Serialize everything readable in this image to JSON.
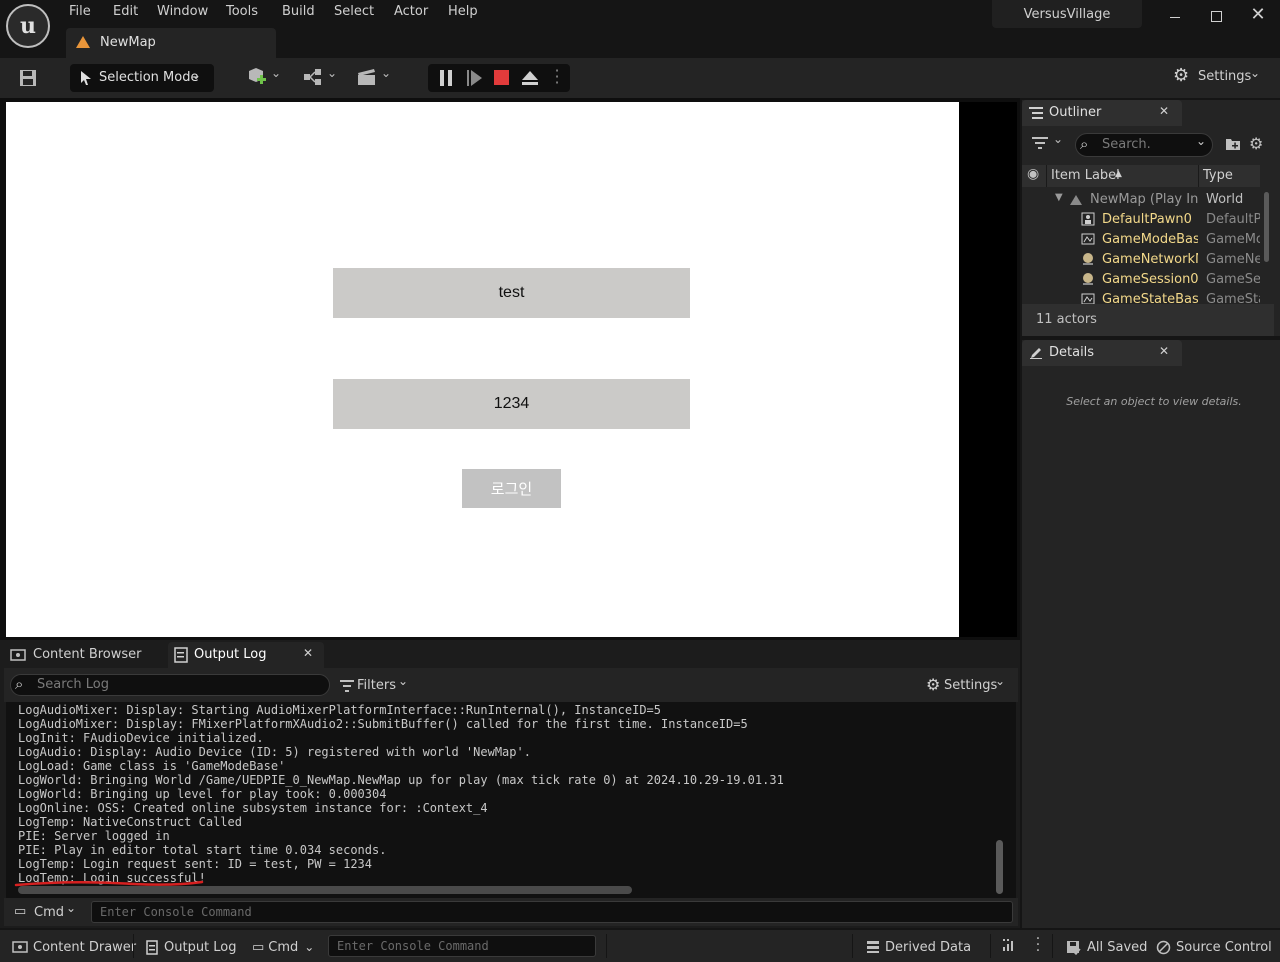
{
  "menu": [
    "File",
    "Edit",
    "Window",
    "Tools",
    "Build",
    "Select",
    "Actor",
    "Help"
  ],
  "project_name": "VersusVillage",
  "tab": {
    "label": "NewMap"
  },
  "toolbar": {
    "selection_mode": "Selection Mode",
    "settings": "Settings"
  },
  "viewport": {
    "id_value": "test",
    "pw_value": "1234",
    "login_button": "로그인"
  },
  "outliner": {
    "title": "Outliner",
    "search_placeholder": "Search.",
    "col_label": "Item Label",
    "col_type": "Type",
    "rows": [
      {
        "label": "NewMap (Play In E",
        "type": "World"
      },
      {
        "label": "DefaultPawn0",
        "type": "DefaultPa"
      },
      {
        "label": "GameModeBase",
        "type": "GameMo"
      },
      {
        "label": "GameNetworkMa",
        "type": "GameNet"
      },
      {
        "label": "GameSession0",
        "type": "GameSes"
      },
      {
        "label": "GameStateBase(",
        "type": "GameSta"
      }
    ],
    "count": "11 actors"
  },
  "details": {
    "title": "Details",
    "empty_msg": "Select an object to view details."
  },
  "bottom_tabs": {
    "content_browser": "Content Browser",
    "output_log": "Output Log"
  },
  "output_log": {
    "search_placeholder": "Search Log",
    "filters": "Filters",
    "settings": "Settings",
    "lines": [
      "LogAudioMixer: Display: Starting AudioMixerPlatformInterface::RunInternal(), InstanceID=5",
      "LogAudioMixer: Display: FMixerPlatformXAudio2::SubmitBuffer() called for the first time. InstanceID=5",
      "LogInit: FAudioDevice initialized.",
      "LogAudio: Display: Audio Device (ID: 5) registered with world 'NewMap'.",
      "LogLoad: Game class is 'GameModeBase'",
      "LogWorld: Bringing World /Game/UEDPIE_0_NewMap.NewMap up for play (max tick rate 0) at 2024.10.29-19.01.31",
      "LogWorld: Bringing up level for play took: 0.000304",
      "LogOnline: OSS: Created online subsystem instance for: :Context_4",
      "LogTemp: NativeConstruct Called",
      "PIE: Server logged in",
      "PIE: Play in editor total start time 0.034 seconds.",
      "LogTemp: Login request sent: ID = test, PW = 1234",
      "LogTemp: Login successful!"
    ],
    "cmd_label": "Cmd",
    "cmd_placeholder": "Enter Console Command"
  },
  "statusbar": {
    "content_drawer": "Content Drawer",
    "output_log": "Output Log",
    "cmd": "Cmd",
    "cmd_placeholder": "Enter Console Command",
    "derived_data": "Derived Data",
    "all_saved": "All Saved",
    "source_control": "Source Control"
  },
  "colors": {
    "stop_red": "#e23b3b",
    "annotation_red": "#d62020",
    "actor_yellow": "#f2d88a"
  }
}
